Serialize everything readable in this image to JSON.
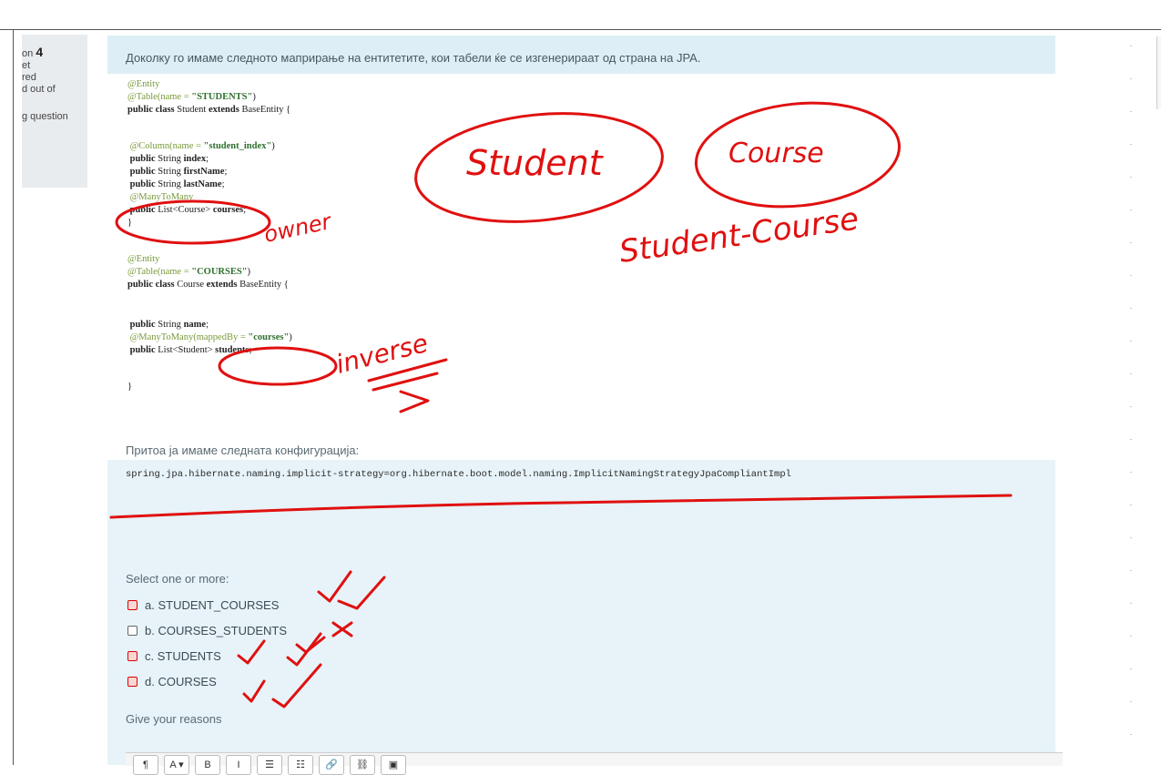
{
  "info": {
    "question_prefix": "on",
    "question_number": "4",
    "lines": [
      "et",
      "red",
      "d out of",
      "",
      "g question"
    ]
  },
  "question": {
    "text": "Доколку го имаме следното маприрање на ентитетите, кои табели ќе се изгенерираат од страна на JPA.",
    "config_label": "Притоа ја имаме следната конфигурација:",
    "config_code": "spring.jpa.hibernate.naming.implicit-strategy=org.hibernate.boot.model.naming.ImplicitNamingStrategyJpaCompliantImpl",
    "prompt": "Select one or more:",
    "options": [
      {
        "label": "a. STUDENT_COURSES",
        "checked": true
      },
      {
        "label": "b. COURSES_STUDENTS",
        "checked": false
      },
      {
        "label": "c. STUDENTS",
        "checked": true
      },
      {
        "label": "d. COURSES",
        "checked": true
      }
    ],
    "reasons_label": "Give your reasons"
  },
  "code": {
    "l1": "@Entity",
    "l2a": "@Table(name = ",
    "l2b": "\"STUDENTS\"",
    "l2c": ")",
    "l3a": "public class",
    "l3b": " Student ",
    "l3c": "extends",
    "l3d": " BaseEntity {",
    "l4a": " @Column(name = ",
    "l4b": "\"student_index\"",
    "l4c": ")",
    "l5a": " public",
    "l5b": " String ",
    "l5c": "index",
    "l6a": " public",
    "l6b": " String ",
    "l6c": "firstName",
    "l7a": " public",
    "l7b": " String ",
    "l7c": "lastName",
    "l8": " @ManyToMany",
    "l9a": " public",
    "l9b": " List<Course> ",
    "l9c": "courses",
    "l10": "}",
    "l11": "@Entity",
    "l12a": "@Table(name = ",
    "l12b": "\"COURSES\"",
    "l12c": ")",
    "l13a": "public class",
    "l13b": " Course ",
    "l13c": "extends",
    "l13d": " BaseEntity {",
    "l14a": " public",
    "l14b": " String ",
    "l14c": "name",
    "l15a": " @ManyToMany(mappedBy = ",
    "l15b": "\"courses\"",
    "l15c": ")",
    "l16a": " public",
    "l16b": " List<Student> ",
    "l16c": "students",
    "l17": "}"
  },
  "handwriting": {
    "student": "Student",
    "course": "Course",
    "join": "Student-Course",
    "owner": "owner",
    "inverse": "inverse"
  },
  "toolbar": [
    "¶",
    "A ▾",
    "B",
    "I",
    "☰",
    "☷",
    "🔗",
    "⛓",
    "▣"
  ],
  "colors": {
    "ink": "#e01010",
    "panel": "#e7f3f8"
  }
}
